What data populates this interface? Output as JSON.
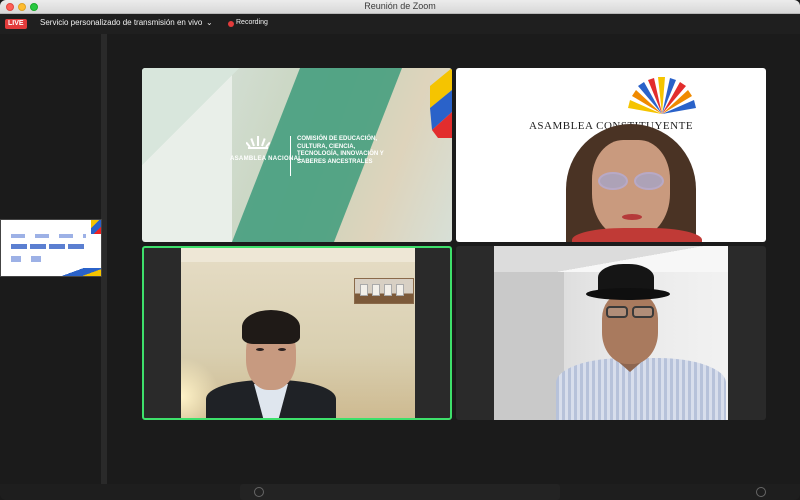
{
  "window": {
    "title": "Reunión de Zoom"
  },
  "topbar": {
    "live_label": "LIVE",
    "stream_label": "Servicio personalizado de transmisión en vivo",
    "recording_label": "Recording"
  },
  "colors": {
    "live": "#e23b3b",
    "active_speaker_border": "#3ee06b",
    "commission_green": "#3e9b7b"
  },
  "tiles": {
    "presentation": {
      "org_name": "ASAMBLEA NACIONAL",
      "commission_text": "COMISIÓN DE EDUCACIÓN, CULTURA, CIENCIA, TECNOLOGÍA, INNOVACIÓN Y SABERES ANCESTRALES"
    },
    "asamblea": {
      "brand": "ASAMBLEA CONSTITUYENTE"
    }
  },
  "icons": [
    "chevron-down-icon",
    "recording-dot-icon",
    "asamblea-sun-logo-icon"
  ]
}
